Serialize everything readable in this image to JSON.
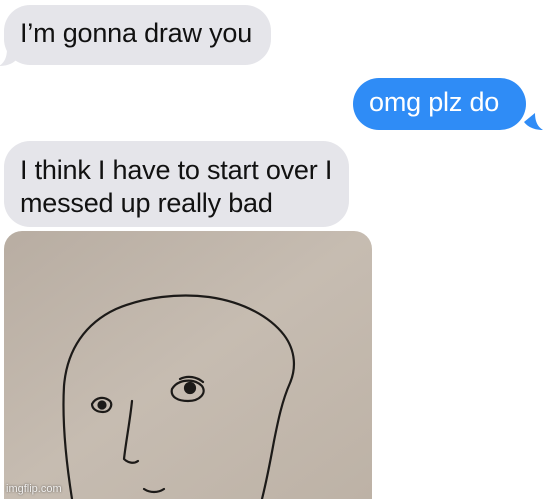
{
  "conversation": {
    "messages": [
      {
        "from": "them",
        "lines": [
          "I’m gonna draw you"
        ]
      },
      {
        "from": "me",
        "lines": [
          "omg plz do"
        ]
      },
      {
        "from": "them",
        "lines": [
          "I think I have to start over I",
          "messed up really bad"
        ]
      }
    ],
    "attachment": {
      "type": "photo",
      "subject": "pen-sketch-face",
      "watermark": "imgflip.com"
    }
  },
  "colors": {
    "incoming_bubble": "#e5e5ea",
    "outgoing_bubble": "#2f8cf6",
    "paper": "#c2b7ab"
  }
}
